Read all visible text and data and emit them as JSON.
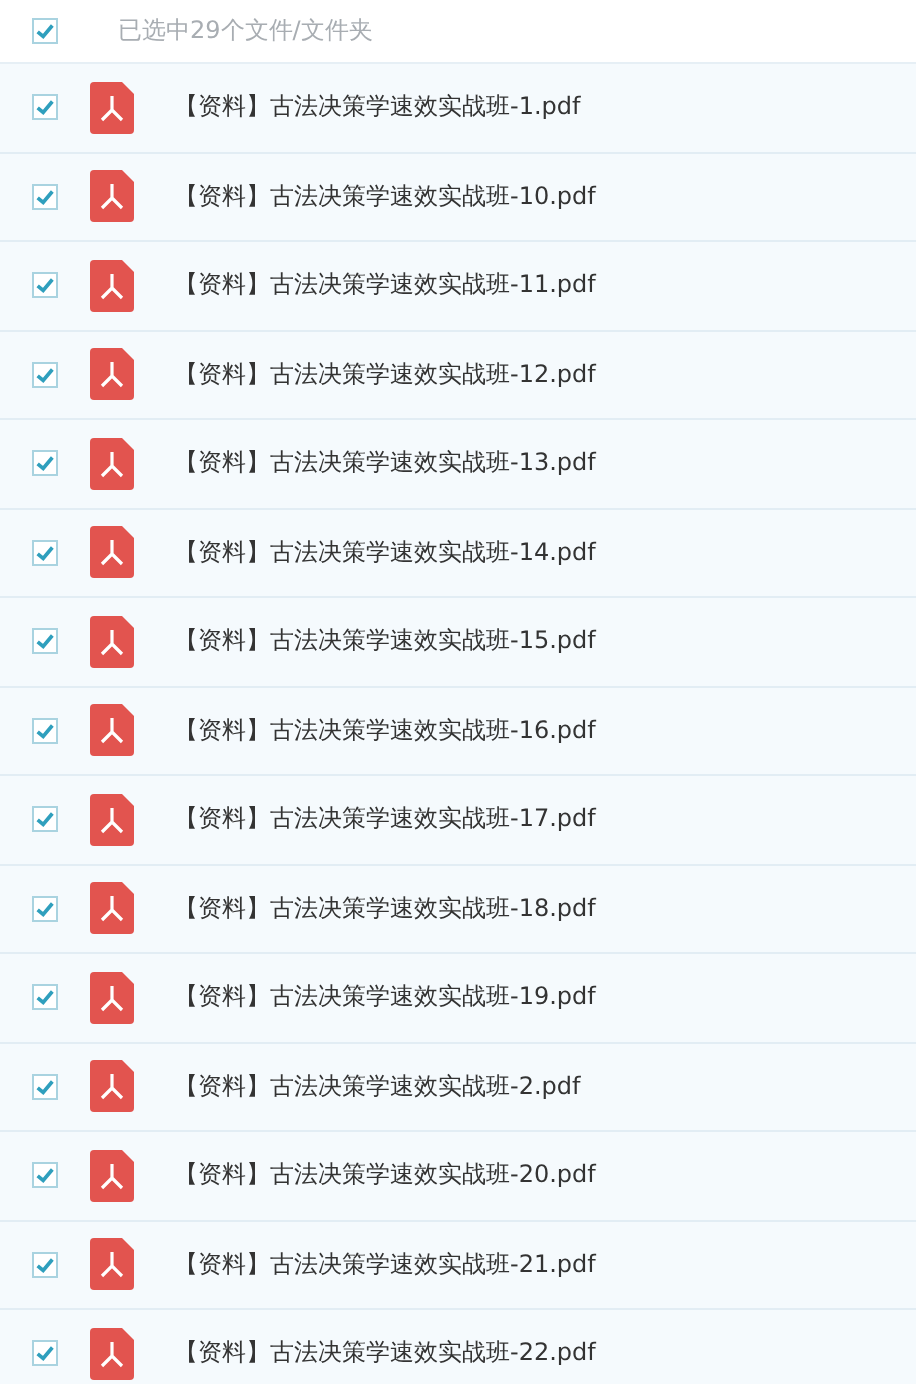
{
  "header": {
    "checked": true,
    "label": "已选中29个文件/文件夹"
  },
  "files": [
    {
      "name": "【资料】古法决策学速效实战班-1.pdf",
      "checked": true
    },
    {
      "name": "【资料】古法决策学速效实战班-10.pdf",
      "checked": true
    },
    {
      "name": "【资料】古法决策学速效实战班-11.pdf",
      "checked": true
    },
    {
      "name": "【资料】古法决策学速效实战班-12.pdf",
      "checked": true
    },
    {
      "name": "【资料】古法决策学速效实战班-13.pdf",
      "checked": true
    },
    {
      "name": "【资料】古法决策学速效实战班-14.pdf",
      "checked": true
    },
    {
      "name": "【资料】古法决策学速效实战班-15.pdf",
      "checked": true
    },
    {
      "name": "【资料】古法决策学速效实战班-16.pdf",
      "checked": true
    },
    {
      "name": "【资料】古法决策学速效实战班-17.pdf",
      "checked": true
    },
    {
      "name": "【资料】古法决策学速效实战班-18.pdf",
      "checked": true
    },
    {
      "name": "【资料】古法决策学速效实战班-19.pdf",
      "checked": true
    },
    {
      "name": "【资料】古法决策学速效实战班-2.pdf",
      "checked": true
    },
    {
      "name": "【资料】古法决策学速效实战班-20.pdf",
      "checked": true
    },
    {
      "name": "【资料】古法决策学速效实战班-21.pdf",
      "checked": true
    },
    {
      "name": "【资料】古法决策学速效实战班-22.pdf",
      "checked": true
    }
  ]
}
